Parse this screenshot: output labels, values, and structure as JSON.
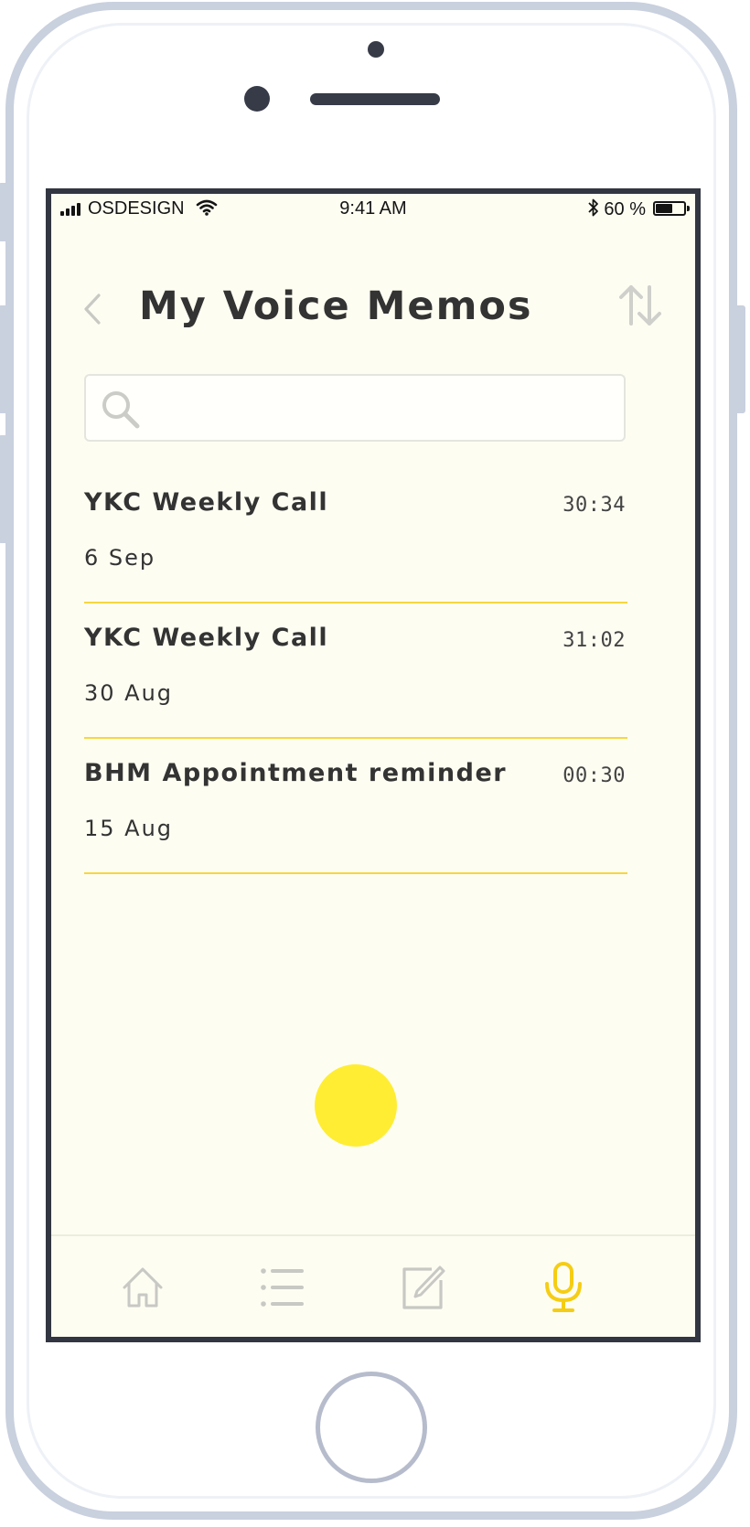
{
  "status_bar": {
    "carrier": "OSDESIGN",
    "time": "9:41 AM",
    "battery_percent": "60 %",
    "battery_level": 0.6,
    "icons": [
      "signal-icon",
      "wifi-icon",
      "bluetooth-icon",
      "battery-icon"
    ]
  },
  "header": {
    "title": "My Voice Memos",
    "back_icon": "chevron-left-icon",
    "sort_icon": "sort-arrows-icon"
  },
  "search": {
    "placeholder": "",
    "value": "",
    "icon": "search-icon"
  },
  "memos": [
    {
      "title": "YKC Weekly Call",
      "date": "6 Sep",
      "duration": "30:34"
    },
    {
      "title": "YKC Weekly Call",
      "date": "30 Aug",
      "duration": "31:02"
    },
    {
      "title": "BHM Appointment reminder",
      "date": "15 Aug",
      "duration": "00:30"
    }
  ],
  "record_button": {
    "color": "#ffed33"
  },
  "tab_bar": {
    "tabs": [
      {
        "icon": "home-icon",
        "active": false
      },
      {
        "icon": "list-icon",
        "active": false
      },
      {
        "icon": "edit-icon",
        "active": false
      },
      {
        "icon": "microphone-icon",
        "active": true
      }
    ],
    "active_color": "#f5cd14",
    "inactive_color": "#c8c8c4"
  },
  "colors": {
    "screen_background": "#fefdf2",
    "divider": "#f7d640",
    "text": "#333333",
    "phone_frame": "#c9d0de"
  }
}
